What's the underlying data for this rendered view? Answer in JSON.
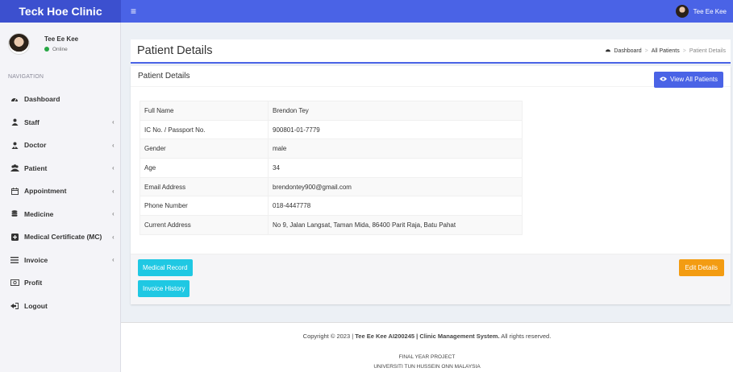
{
  "header": {
    "brand": "Teck Hoe Clinic",
    "menu_icon": "bars-icon",
    "user_name": "Tee Ee Kee"
  },
  "sidebar": {
    "user_name": "Tee Ee Kee",
    "status": "Online",
    "nav_header": "NAVIGATION",
    "items": [
      {
        "label": "Dashboard",
        "icon": "dashboard-icon"
      },
      {
        "label": "Staff",
        "icon": "user-icon"
      },
      {
        "label": "Doctor",
        "icon": "user-md-icon"
      },
      {
        "label": "Patient",
        "icon": "users-icon"
      },
      {
        "label": "Appointment",
        "icon": "calendar-icon"
      },
      {
        "label": "Medicine",
        "icon": "database-icon"
      },
      {
        "label": "Medical Certificate (MC)",
        "icon": "plus-square-icon"
      },
      {
        "label": "Invoice",
        "icon": "list-icon"
      },
      {
        "label": "Profit",
        "icon": "money-icon"
      },
      {
        "label": "Logout",
        "icon": "sign-out-icon"
      }
    ]
  },
  "page": {
    "title": "Patient Details",
    "breadcrumb": [
      "Dashboard",
      "All Patients",
      "Patient Details"
    ]
  },
  "box": {
    "title": "Patient Details",
    "view_all_label": "View All Patients",
    "rows": [
      {
        "label": "Full Name",
        "value": "Brendon Tey"
      },
      {
        "label": "IC No. / Passport No.",
        "value": "900801-01-7779"
      },
      {
        "label": "Gender",
        "value": "male"
      },
      {
        "label": "Age",
        "value": "34"
      },
      {
        "label": "Email Address",
        "value": "brendontey900@gmail.com"
      },
      {
        "label": "Phone Number",
        "value": "018-4447778"
      },
      {
        "label": "Current Address",
        "value": "No 9, Jalan Langsat, Taman Mida, 86400 Parit Raja, Batu Pahat"
      }
    ],
    "medical_record_label": "Medical Record",
    "invoice_history_label": "Invoice History",
    "edit_label": "Edit Details"
  },
  "footer": {
    "copyright_prefix": "Copyright © 2023 | ",
    "copyright_bold": "Tee Ee Kee AI200245 | Clinic Management System.",
    "copyright_suffix": " All rights reserved.",
    "line2": "FINAL YEAR PROJECT",
    "line3": "UNIVERSITI TUN HUSSEIN ONN MALAYSIA"
  },
  "colors": {
    "primary": "#4a63e6",
    "brand_bar": "#3c50cf",
    "info": "#1fc8e3",
    "warning": "#f39c12",
    "online": "#28a745"
  }
}
